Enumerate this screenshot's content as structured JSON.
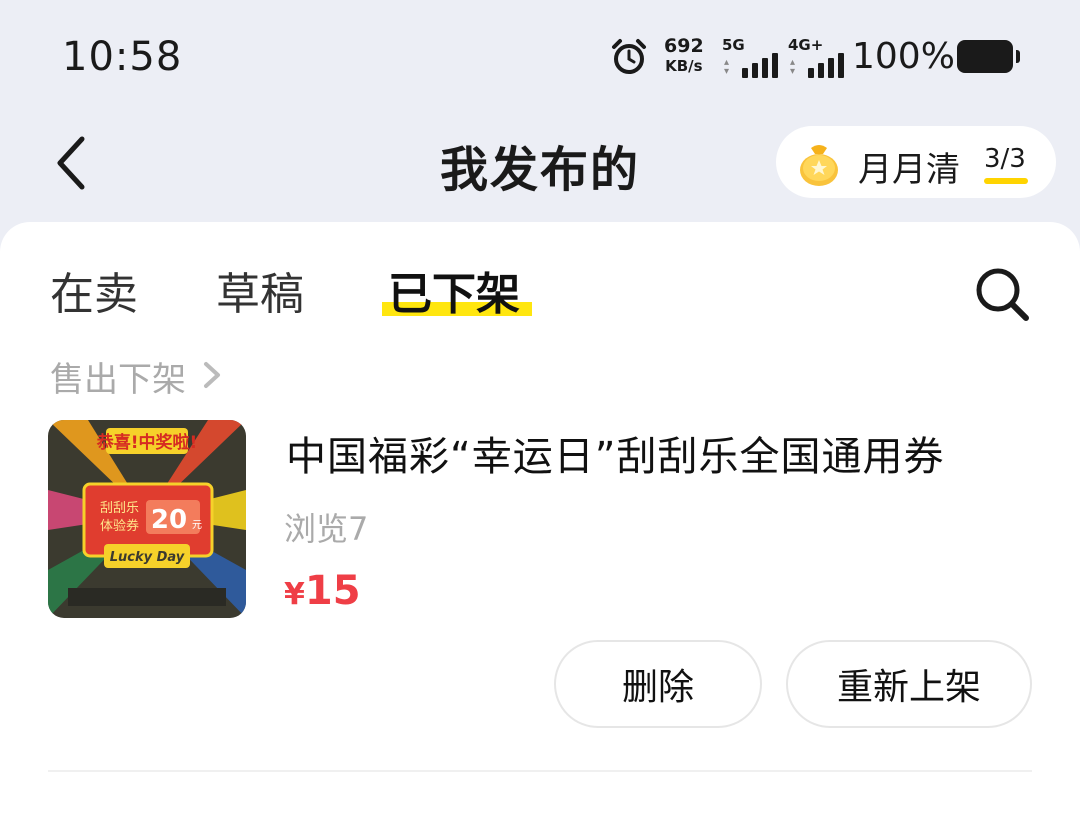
{
  "status_bar": {
    "time": "10:58",
    "net_speed_value": "692",
    "net_speed_unit": "KB/s",
    "sim1_label": "5G",
    "sim2_label": "4G+",
    "battery_percent": "100%",
    "icons": [
      "alarm-icon",
      "signal-icon",
      "battery-icon"
    ]
  },
  "header": {
    "title": "我发布的",
    "back_icon": "chevron-left-icon",
    "monthly_pill": {
      "label": "月月清",
      "count": "3/3",
      "icon": "money-bag-icon"
    }
  },
  "tabs": [
    {
      "label": "在卖",
      "active": false
    },
    {
      "label": "草稿",
      "active": false
    },
    {
      "label": "已下架",
      "active": true
    }
  ],
  "search_icon": "search-icon",
  "section": {
    "label": "售出下架"
  },
  "item": {
    "title": "中国福彩“幸运日”刮刮乐全国通用券",
    "views": "浏览7",
    "price_currency": "¥",
    "price_value": "15",
    "thumbnail": {
      "banner": "恭喜!中奖啦!",
      "ticket_line1": "刮刮乐",
      "ticket_line2": "体验券",
      "amount": "20",
      "amount_unit": "元",
      "ribbon": "Lucky Day"
    }
  },
  "actions": {
    "delete_label": "删除",
    "relist_label": "重新上架"
  },
  "colors": {
    "accent_yellow": "#ffe60f",
    "price_red": "#ef3e46",
    "background": "#eceef5"
  }
}
